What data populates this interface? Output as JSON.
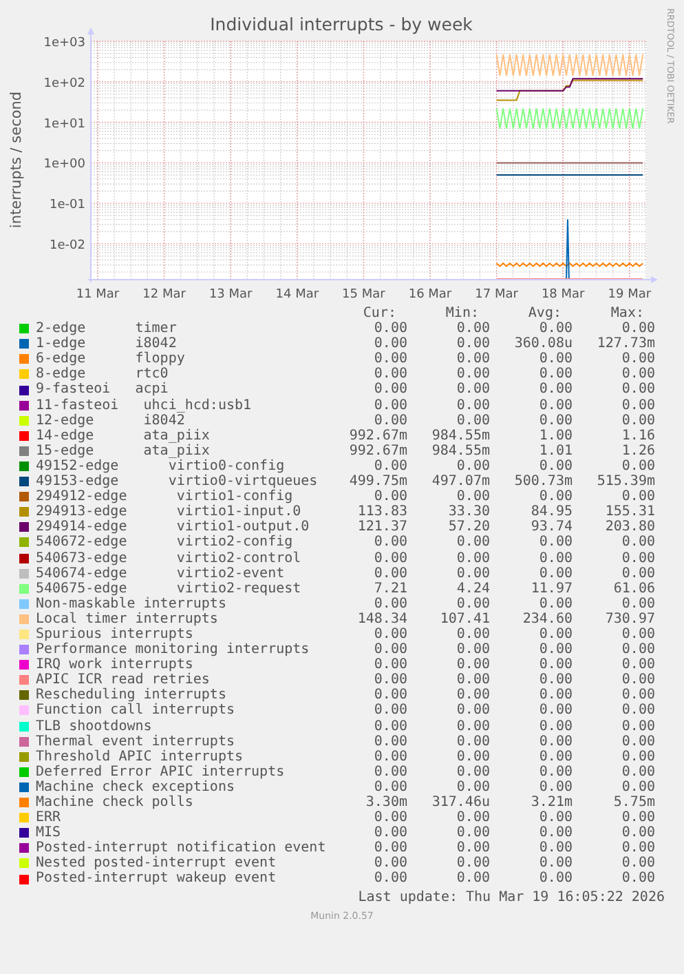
{
  "graph": {
    "title": "Individual interrupts - by week",
    "credit": "RRDTOOL / TOBI OETIKER",
    "ylabel": "interrupts / second",
    "yticks": [
      "1e+03",
      "1e+02",
      "1e+01",
      "1e+00",
      "1e-01",
      "1e-02"
    ],
    "xticks": [
      "11 Mar",
      "12 Mar",
      "13 Mar",
      "14 Mar",
      "15 Mar",
      "16 Mar",
      "17 Mar",
      "18 Mar",
      "19 Mar"
    ]
  },
  "legend": {
    "columns": [
      "Cur:",
      "Min:",
      "Avg:",
      "Max:"
    ],
    "rows": [
      {
        "label": "2-edge      timer",
        "color": "#00cc00",
        "cur": "0.00",
        "min": "0.00",
        "avg": "0.00",
        "max": "0.00"
      },
      {
        "label": "1-edge      i8042",
        "color": "#0066b3",
        "cur": "0.00",
        "min": "0.00",
        "avg": "360.08u",
        "max": "127.73m"
      },
      {
        "label": "6-edge      floppy",
        "color": "#ff8000",
        "cur": "0.00",
        "min": "0.00",
        "avg": "0.00",
        "max": "0.00"
      },
      {
        "label": "8-edge      rtc0",
        "color": "#ffcc00",
        "cur": "0.00",
        "min": "0.00",
        "avg": "0.00",
        "max": "0.00"
      },
      {
        "label": "9-fasteoi   acpi",
        "color": "#330099",
        "cur": "0.00",
        "min": "0.00",
        "avg": "0.00",
        "max": "0.00"
      },
      {
        "label": "11-fasteoi   uhci_hcd:usb1",
        "color": "#990099",
        "cur": "0.00",
        "min": "0.00",
        "avg": "0.00",
        "max": "0.00"
      },
      {
        "label": "12-edge      i8042",
        "color": "#ccff00",
        "cur": "0.00",
        "min": "0.00",
        "avg": "0.00",
        "max": "0.00"
      },
      {
        "label": "14-edge      ata_piix",
        "color": "#ff0000",
        "cur": "992.67m",
        "min": "984.55m",
        "avg": "1.00",
        "max": "1.16"
      },
      {
        "label": "15-edge      ata_piix",
        "color": "#808080",
        "cur": "992.67m",
        "min": "984.55m",
        "avg": "1.01",
        "max": "1.26"
      },
      {
        "label": "49152-edge      virtio0-config",
        "color": "#008f00",
        "cur": "0.00",
        "min": "0.00",
        "avg": "0.00",
        "max": "0.00"
      },
      {
        "label": "49153-edge      virtio0-virtqueues",
        "color": "#00487d",
        "cur": "499.75m",
        "min": "497.07m",
        "avg": "500.73m",
        "max": "515.39m"
      },
      {
        "label": "294912-edge      virtio1-config",
        "color": "#b35a00",
        "cur": "0.00",
        "min": "0.00",
        "avg": "0.00",
        "max": "0.00"
      },
      {
        "label": "294913-edge      virtio1-input.0",
        "color": "#b38f00",
        "cur": "113.83",
        "min": "33.30",
        "avg": "84.95",
        "max": "155.31"
      },
      {
        "label": "294914-edge      virtio1-output.0",
        "color": "#6b006b",
        "cur": "121.37",
        "min": "57.20",
        "avg": "93.74",
        "max": "203.80"
      },
      {
        "label": "540672-edge      virtio2-config",
        "color": "#8fb300",
        "cur": "0.00",
        "min": "0.00",
        "avg": "0.00",
        "max": "0.00"
      },
      {
        "label": "540673-edge      virtio2-control",
        "color": "#b30000",
        "cur": "0.00",
        "min": "0.00",
        "avg": "0.00",
        "max": "0.00"
      },
      {
        "label": "540674-edge      virtio2-event",
        "color": "#bebebe",
        "cur": "0.00",
        "min": "0.00",
        "avg": "0.00",
        "max": "0.00"
      },
      {
        "label": "540675-edge      virtio2-request",
        "color": "#80ff80",
        "cur": "7.21",
        "min": "4.24",
        "avg": "11.97",
        "max": "61.06"
      },
      {
        "label": "Non-maskable interrupts",
        "color": "#80c9ff",
        "cur": "0.00",
        "min": "0.00",
        "avg": "0.00",
        "max": "0.00"
      },
      {
        "label": "Local timer interrupts",
        "color": "#ffc080",
        "cur": "148.34",
        "min": "107.41",
        "avg": "234.60",
        "max": "730.97"
      },
      {
        "label": "Spurious interrupts",
        "color": "#ffe680",
        "cur": "0.00",
        "min": "0.00",
        "avg": "0.00",
        "max": "0.00"
      },
      {
        "label": "Performance monitoring interrupts",
        "color": "#aa80ff",
        "cur": "0.00",
        "min": "0.00",
        "avg": "0.00",
        "max": "0.00"
      },
      {
        "label": "IRQ work interrupts",
        "color": "#ee00cc",
        "cur": "0.00",
        "min": "0.00",
        "avg": "0.00",
        "max": "0.00"
      },
      {
        "label": "APIC ICR read retries",
        "color": "#ff8080",
        "cur": "0.00",
        "min": "0.00",
        "avg": "0.00",
        "max": "0.00"
      },
      {
        "label": "Rescheduling interrupts",
        "color": "#666600",
        "cur": "0.00",
        "min": "0.00",
        "avg": "0.00",
        "max": "0.00"
      },
      {
        "label": "Function call interrupts",
        "color": "#ffbfff",
        "cur": "0.00",
        "min": "0.00",
        "avg": "0.00",
        "max": "0.00"
      },
      {
        "label": "TLB shootdowns",
        "color": "#00ffcc",
        "cur": "0.00",
        "min": "0.00",
        "avg": "0.00",
        "max": "0.00"
      },
      {
        "label": "Thermal event interrupts",
        "color": "#cc6699",
        "cur": "0.00",
        "min": "0.00",
        "avg": "0.00",
        "max": "0.00"
      },
      {
        "label": "Threshold APIC interrupts",
        "color": "#999900",
        "cur": "0.00",
        "min": "0.00",
        "avg": "0.00",
        "max": "0.00"
      },
      {
        "label": "Deferred Error APIC interrupts",
        "color": "#00cc00",
        "cur": "0.00",
        "min": "0.00",
        "avg": "0.00",
        "max": "0.00"
      },
      {
        "label": "Machine check exceptions",
        "color": "#0066b3",
        "cur": "0.00",
        "min": "0.00",
        "avg": "0.00",
        "max": "0.00"
      },
      {
        "label": "Machine check polls",
        "color": "#ff8000",
        "cur": "3.30m",
        "min": "317.46u",
        "avg": "3.21m",
        "max": "5.75m"
      },
      {
        "label": "ERR",
        "color": "#ffcc00",
        "cur": "0.00",
        "min": "0.00",
        "avg": "0.00",
        "max": "0.00"
      },
      {
        "label": "MIS",
        "color": "#330099",
        "cur": "0.00",
        "min": "0.00",
        "avg": "0.00",
        "max": "0.00"
      },
      {
        "label": "Posted-interrupt notification event",
        "color": "#990099",
        "cur": "0.00",
        "min": "0.00",
        "avg": "0.00",
        "max": "0.00"
      },
      {
        "label": "Nested posted-interrupt event",
        "color": "#ccff00",
        "cur": "0.00",
        "min": "0.00",
        "avg": "0.00",
        "max": "0.00"
      },
      {
        "label": "Posted-interrupt wakeup event",
        "color": "#ff0000",
        "cur": "0.00",
        "min": "0.00",
        "avg": "0.00",
        "max": "0.00"
      }
    ]
  },
  "last_update": "Last update: Thu Mar 19 16:05:22 2026",
  "footer": "Munin 2.0.57"
}
